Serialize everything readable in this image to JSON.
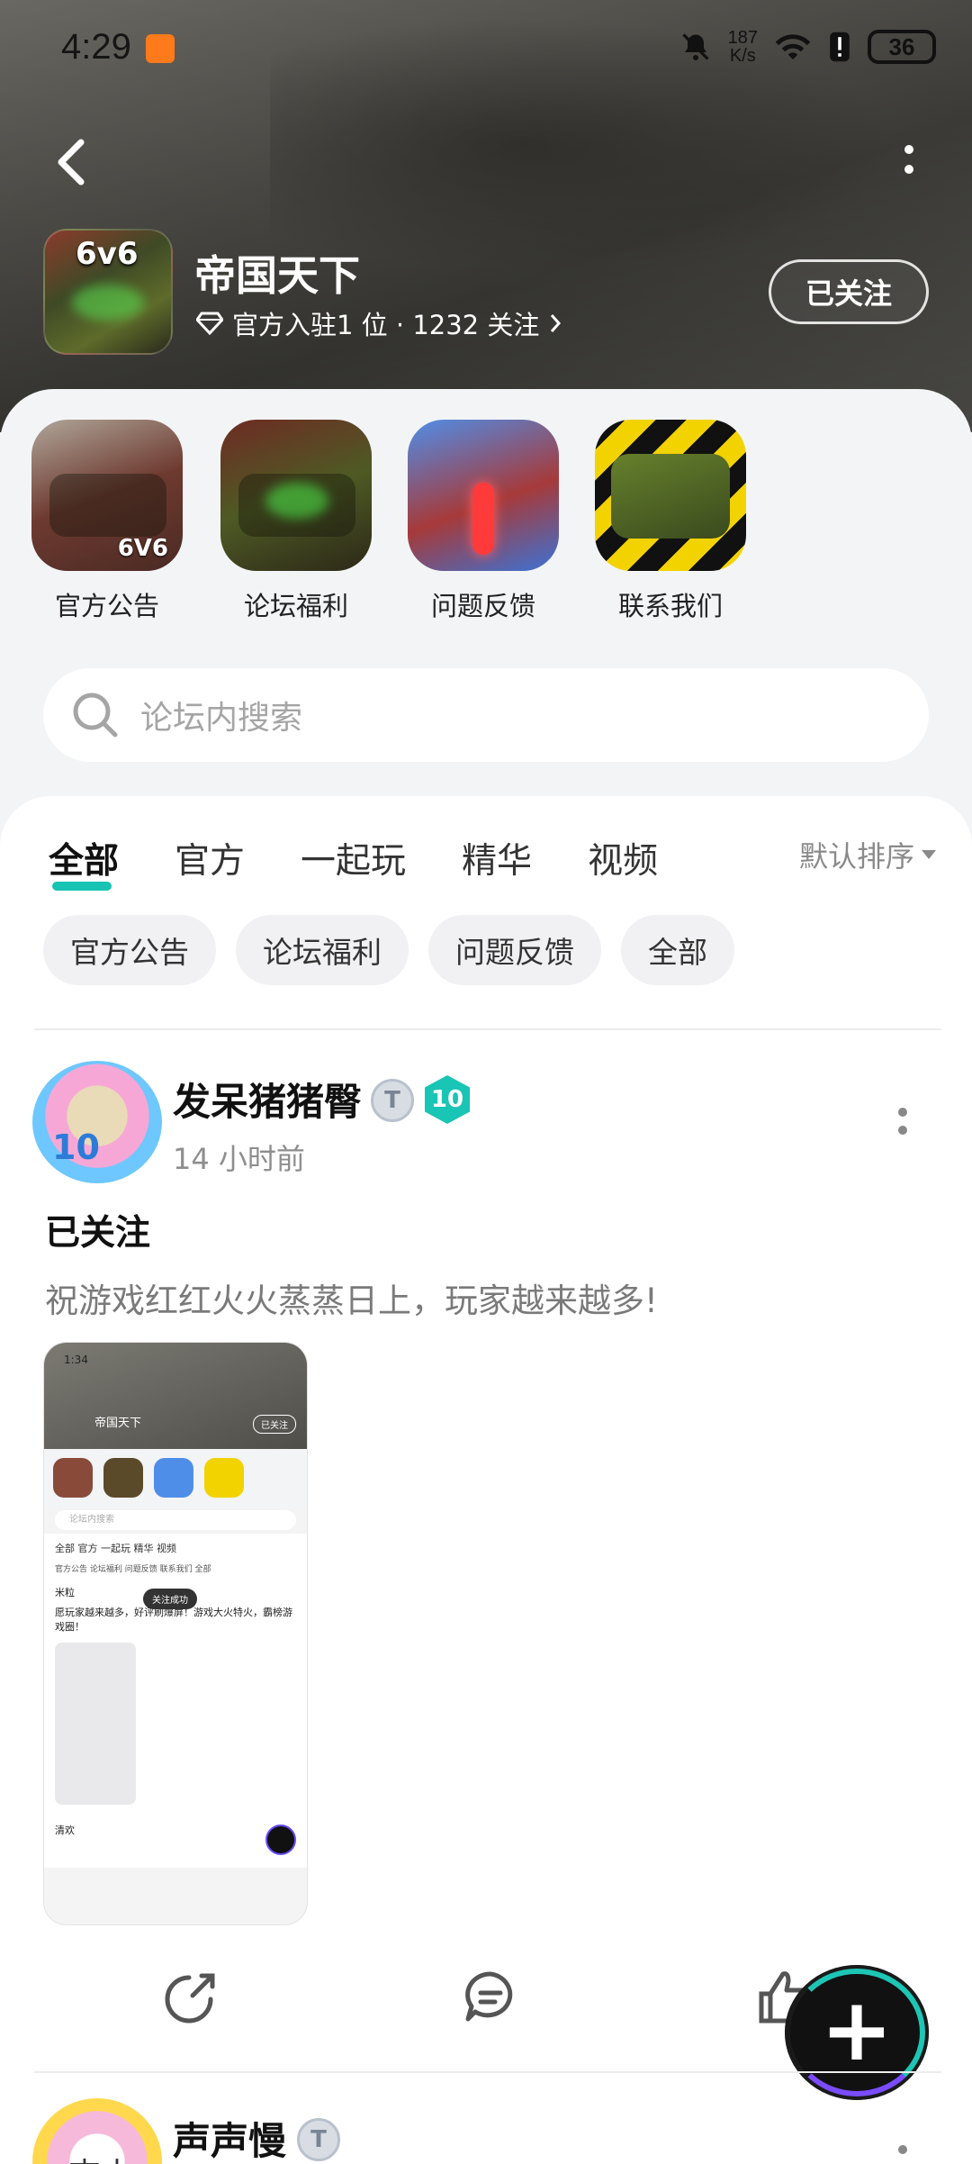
{
  "status": {
    "time": "4:29",
    "net_speed_value": "187",
    "net_speed_unit": "K/s",
    "battery": "36"
  },
  "header": {
    "game_title": "帝国天下",
    "game_icon_text": "6v6",
    "official_info": "官方入驻1 位 · 1232 关注",
    "follow_button": "已关注"
  },
  "shortcuts": [
    {
      "label": "官方公告",
      "tag": "6V6"
    },
    {
      "label": "论坛福利"
    },
    {
      "label": "问题反馈"
    },
    {
      "label": "联系我们"
    }
  ],
  "search": {
    "placeholder": "论坛内搜索"
  },
  "tabs": [
    {
      "label": "全部",
      "active": true
    },
    {
      "label": "官方"
    },
    {
      "label": "一起玩"
    },
    {
      "label": "精华"
    },
    {
      "label": "视频"
    }
  ],
  "sort": {
    "label": "默认排序"
  },
  "chips": [
    "官方公告",
    "论坛福利",
    "问题反馈",
    "全部"
  ],
  "post1": {
    "author": "发呆猪猪臀",
    "level": "10",
    "time": "14 小时前",
    "title": "已关注",
    "body": "祝游戏红红火火蒸蒸日上，玩家越来越多!",
    "avatar_text": "10",
    "thumb": {
      "time": "1:34",
      "game_title": "帝国天下",
      "follow": "已关注",
      "search": "论坛内搜索",
      "tabs": "全部  官方  一起玩  精华  视频",
      "chips": "官方公告  论坛福利  问题反馈  联系我们  全部",
      "poster": "米粒",
      "post_text": "愿玩家越来越多，好评刷爆屏！游戏大火特火，霸榜游戏圈！",
      "toast": "关注成功",
      "next_poster": "清欢"
    }
  },
  "post2": {
    "author": "声声慢",
    "avatar_text": "吉山昌"
  },
  "colors": {
    "accent": "#17c3b2",
    "fab_purple": "#7a4cff",
    "status_app": "#ff7a1a"
  }
}
